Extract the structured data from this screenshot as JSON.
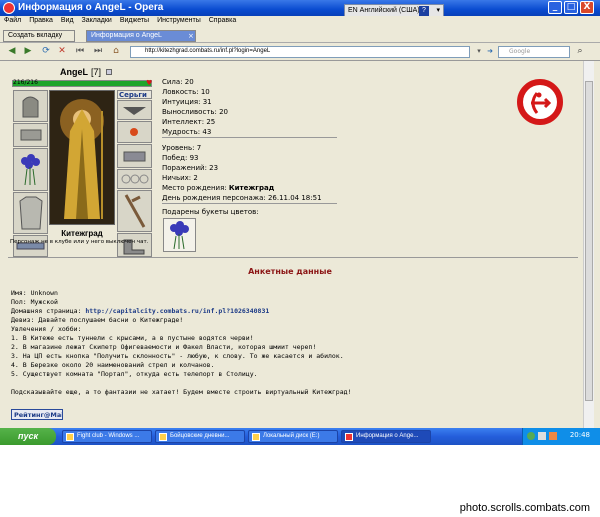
{
  "window": {
    "title": "Информация о AngeL - Opera",
    "lang_indicator": "EN Английский (США)",
    "help_label": "?",
    "min_label": "_",
    "max_label": "□",
    "close_label": "X"
  },
  "menu": [
    "Файл",
    "Правка",
    "Вид",
    "Закладки",
    "Виджеты",
    "Инструменты",
    "Справка"
  ],
  "tabs": {
    "new_tab": "Создать вкладку",
    "active_tab": "Информация о AngeL"
  },
  "address": {
    "url": "http://kitezhgrad.combats.ru/inf.pl?login=AngeL",
    "search_placeholder": "Google"
  },
  "character": {
    "name": "AngeL",
    "level": "[7]",
    "hp": "216/216",
    "hp_fraction": 1.0,
    "shirt_label": "Серьги",
    "city": "Китежград",
    "club_status": "Персонаж не в клубе или у него выключен чат."
  },
  "stats": [
    "Сила: 20",
    "Ловкость: 10",
    "Интуиция: 31",
    "Выносливость: 20",
    "Интеллект: 25",
    "Мудрость: 43"
  ],
  "record": {
    "level": "Уровень: 7",
    "wins": "Побед: 93",
    "losses": "Поражений: 23",
    "draws": "Ничьих: 2",
    "birthplace_label": "Место рождения: ",
    "birthplace": "Китежград",
    "birthday": "День рождения персонажа: 26.11.04 18:51"
  },
  "gifts_title": "Подарены букеты цветов:",
  "profile": {
    "section_title": "Анкетные данные",
    "name": "Имя: Unknown",
    "gender": "Пол: Мужской",
    "homepage_label": "Домашняя страница: ",
    "homepage_url": "http://capitalcity.combats.ru/inf.pl?1026340831",
    "motto": "Девиз: Давайте послушаем басни о Китежграде!",
    "hobbies_label": "Увлечения / хобби:",
    "hobbies": [
      "1. В Китеже есть туннели с крысами, а в пустыне водятся черви!",
      "2. В магазине лежат Скипетр Офигеваемости и Факел Власти, которая шмиит череп!",
      "3. На ЦП есть кнопка \"Получить склонность\" - любую, к слову. То же касается и абилок.",
      "4. В Березке около 20 наименований стрел и колчанов.",
      "5. Существует комната \"Портал\", откуда есть телепорт в Столицу."
    ],
    "closing": "Подсказывайте еще, а то фантазии не хатает! Будем вместе строить виртуальный Китежград!",
    "rating_label": "Рейтинг@Mail"
  },
  "taskbar": {
    "start": "пуск",
    "items": [
      "Fight club - Windows ...",
      "Бойцовские дневни...",
      "Локальный диск (E:)",
      "Информация о Ange..."
    ],
    "clock": "20:48"
  },
  "watermark": "photo.scrolls.combats.com",
  "colors": {
    "hp_bar": "#1fa52b",
    "section_title": "#8b1414",
    "link": "#1c3a86",
    "sign": "#d41818"
  }
}
